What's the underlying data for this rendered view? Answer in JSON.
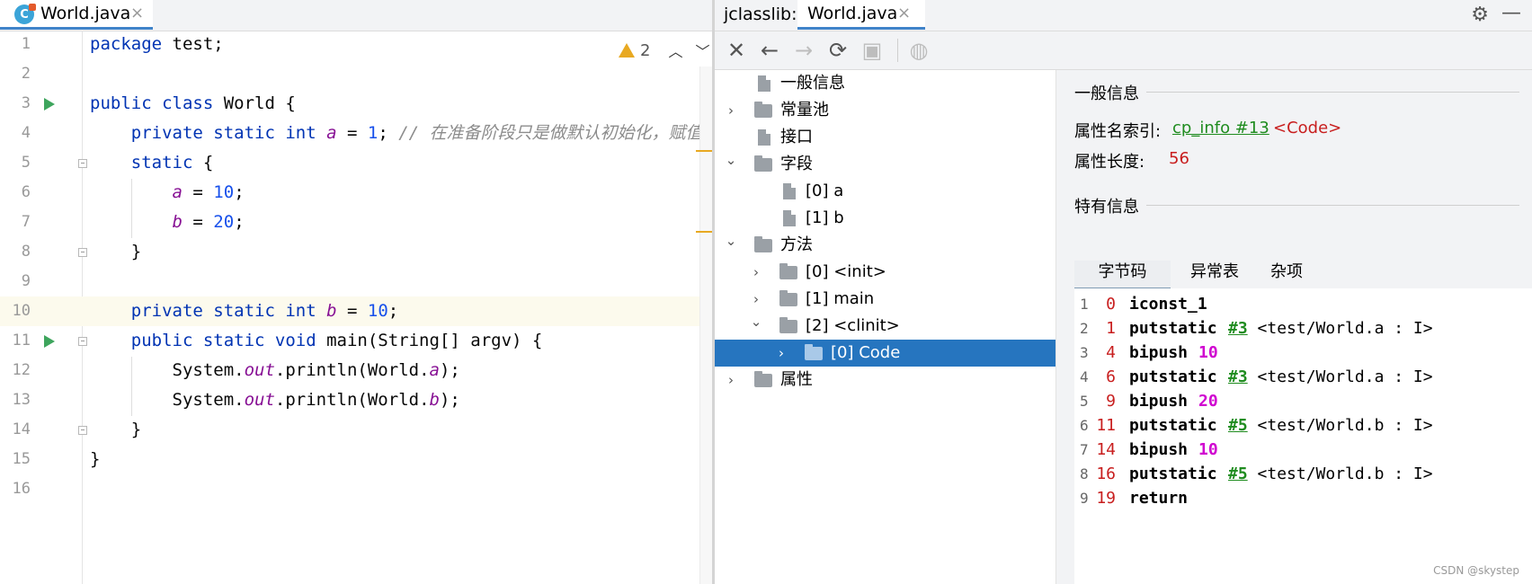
{
  "editor": {
    "tab_label": "World.java",
    "close_glyph": "×",
    "warnings_count": "2",
    "lines": [
      {
        "n": "1",
        "segments": [
          {
            "t": "package ",
            "c": "kw"
          },
          {
            "t": "test;",
            "c": ""
          }
        ]
      },
      {
        "n": "2",
        "segments": []
      },
      {
        "n": "3",
        "segments": [
          {
            "t": "public class ",
            "c": "kw"
          },
          {
            "t": "World {",
            "c": ""
          }
        ]
      },
      {
        "n": "4",
        "segments": [
          {
            "t": "    private static int ",
            "c": "kw"
          },
          {
            "t": "a",
            "c": "fld"
          },
          {
            "t": " = ",
            "c": ""
          },
          {
            "t": "1",
            "c": "num"
          },
          {
            "t": "; ",
            "c": ""
          },
          {
            "t": "// 在准备阶段只是做默认初始化，赋值",
            "c": "cmt"
          }
        ]
      },
      {
        "n": "5",
        "segments": [
          {
            "t": "    static ",
            "c": "kw"
          },
          {
            "t": "{",
            "c": ""
          }
        ]
      },
      {
        "n": "6",
        "segments": [
          {
            "t": "        ",
            "c": ""
          },
          {
            "t": "a",
            "c": "fld"
          },
          {
            "t": " = ",
            "c": ""
          },
          {
            "t": "10",
            "c": "num"
          },
          {
            "t": ";",
            "c": ""
          }
        ]
      },
      {
        "n": "7",
        "segments": [
          {
            "t": "        ",
            "c": ""
          },
          {
            "t": "b",
            "c": "fld"
          },
          {
            "t": " = ",
            "c": ""
          },
          {
            "t": "20",
            "c": "num"
          },
          {
            "t": ";",
            "c": ""
          }
        ]
      },
      {
        "n": "8",
        "segments": [
          {
            "t": "    }",
            "c": ""
          }
        ]
      },
      {
        "n": "9",
        "segments": []
      },
      {
        "n": "10",
        "segments": [
          {
            "t": "    private static int ",
            "c": "kw"
          },
          {
            "t": "b",
            "c": "fld"
          },
          {
            "t": " = ",
            "c": ""
          },
          {
            "t": "10",
            "c": "num"
          },
          {
            "t": ";",
            "c": ""
          }
        ]
      },
      {
        "n": "11",
        "segments": [
          {
            "t": "    public static void ",
            "c": "kw"
          },
          {
            "t": "main(String[] argv) {",
            "c": ""
          }
        ]
      },
      {
        "n": "12",
        "segments": [
          {
            "t": "        System.",
            "c": ""
          },
          {
            "t": "out",
            "c": "fld"
          },
          {
            "t": ".println(World.",
            "c": ""
          },
          {
            "t": "a",
            "c": "fld"
          },
          {
            "t": ");",
            "c": ""
          }
        ]
      },
      {
        "n": "13",
        "segments": [
          {
            "t": "        System.",
            "c": ""
          },
          {
            "t": "out",
            "c": "fld"
          },
          {
            "t": ".println(World.",
            "c": ""
          },
          {
            "t": "b",
            "c": "fld"
          },
          {
            "t": ");",
            "c": ""
          }
        ]
      },
      {
        "n": "14",
        "segments": [
          {
            "t": "    }",
            "c": ""
          }
        ]
      },
      {
        "n": "15",
        "segments": [
          {
            "t": "}",
            "c": ""
          }
        ]
      },
      {
        "n": "16",
        "segments": []
      }
    ]
  },
  "jclasslib": {
    "label": "jclasslib:",
    "tab_label": "World.java",
    "close_glyph": "×",
    "gear_glyph": "⚙",
    "min_glyph": "—",
    "toolbar": {
      "close_glyph": "✕",
      "back_glyph": "←",
      "forward_glyph": "→",
      "reload_glyph": "⟳",
      "save_glyph": "▣",
      "web_glyph": "◍"
    },
    "tree": [
      {
        "label": "一般信息",
        "level": 0,
        "icon": "file",
        "chev": ""
      },
      {
        "label": "常量池",
        "level": 0,
        "icon": "folder",
        "chev": "›"
      },
      {
        "label": "接口",
        "level": 0,
        "icon": "file",
        "chev": ""
      },
      {
        "label": "字段",
        "level": 0,
        "icon": "folder",
        "chev": "⌄"
      },
      {
        "label": "[0] a",
        "level": 1,
        "icon": "file",
        "chev": ""
      },
      {
        "label": "[1] b",
        "level": 1,
        "icon": "file",
        "chev": ""
      },
      {
        "label": "方法",
        "level": 0,
        "icon": "folder",
        "chev": "⌄"
      },
      {
        "label": "[0] <init>",
        "level": 1,
        "icon": "folder",
        "chev": "›"
      },
      {
        "label": "[1] main",
        "level": 1,
        "icon": "folder",
        "chev": "›"
      },
      {
        "label": "[2] <clinit>",
        "level": 1,
        "icon": "folder",
        "chev": "⌄"
      },
      {
        "label": "[0] Code",
        "level": 2,
        "icon": "folder",
        "chev": "›",
        "selected": true
      },
      {
        "label": "属性",
        "level": 0,
        "icon": "folder",
        "chev": "›"
      }
    ],
    "detail": {
      "general_title": "一般信息",
      "attr_name_label": "属性名索引:",
      "attr_name_link": "cp_info #13",
      "attr_name_value": "<Code>",
      "attr_len_label": "属性长度:",
      "attr_len_value": "56",
      "specific_title": "特有信息",
      "tabs": [
        "字节码",
        "异常表",
        "杂项"
      ],
      "active_tab": 0,
      "bytecode": [
        {
          "ln": "1",
          "off": "0",
          "op": "iconst_1",
          "args": []
        },
        {
          "ln": "2",
          "off": "1",
          "op": "putstatic",
          "args": [
            {
              "t": "#3",
              "c": "ref"
            },
            {
              "t": " <test/World.a : I>",
              "c": "com"
            }
          ]
        },
        {
          "ln": "3",
          "off": "4",
          "op": "bipush",
          "args": [
            {
              "t": "10",
              "c": "num"
            }
          ]
        },
        {
          "ln": "4",
          "off": "6",
          "op": "putstatic",
          "args": [
            {
              "t": "#3",
              "c": "ref"
            },
            {
              "t": " <test/World.a : I>",
              "c": "com"
            }
          ]
        },
        {
          "ln": "5",
          "off": "9",
          "op": "bipush",
          "args": [
            {
              "t": "20",
              "c": "num"
            }
          ]
        },
        {
          "ln": "6",
          "off": "11",
          "op": "putstatic",
          "args": [
            {
              "t": "#5",
              "c": "ref"
            },
            {
              "t": " <test/World.b : I>",
              "c": "com"
            }
          ]
        },
        {
          "ln": "7",
          "off": "14",
          "op": "bipush",
          "args": [
            {
              "t": "10",
              "c": "num"
            }
          ]
        },
        {
          "ln": "8",
          "off": "16",
          "op": "putstatic",
          "args": [
            {
              "t": "#5",
              "c": "ref"
            },
            {
              "t": " <test/World.b : I>",
              "c": "com"
            }
          ]
        },
        {
          "ln": "9",
          "off": "19",
          "op": "return",
          "args": []
        }
      ]
    }
  },
  "watermark": "CSDN @skystep"
}
